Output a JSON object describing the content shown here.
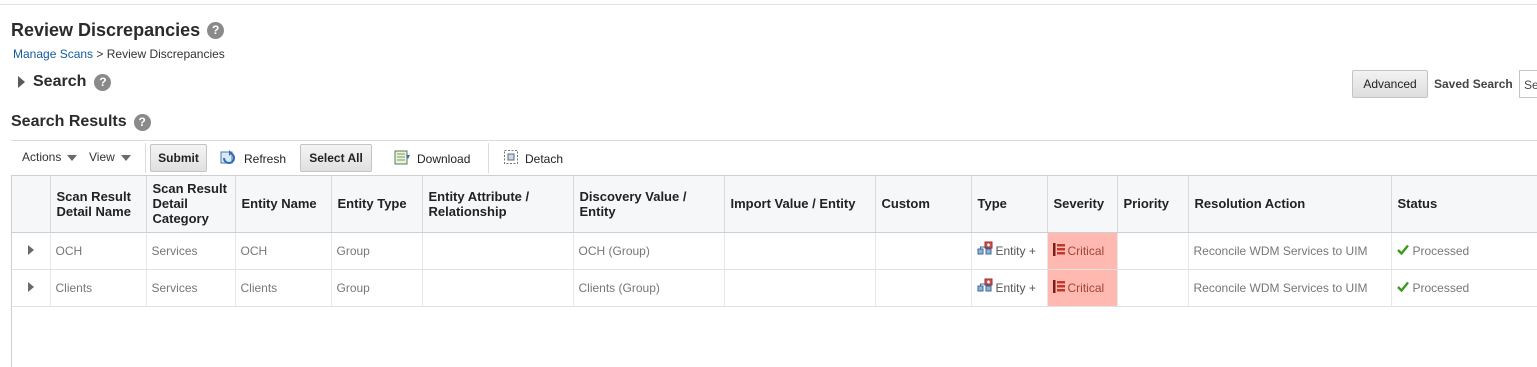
{
  "page": {
    "title": "Review Discrepancies",
    "breadcrumb": {
      "parent": "Manage Scans",
      "separator": ">",
      "current": "Review Discrepancies"
    }
  },
  "search": {
    "label": "Search",
    "advanced_label": "Advanced",
    "saved_search_label": "Saved Search",
    "saved_search_value": "Se"
  },
  "results": {
    "title": "Search Results",
    "toolbar": {
      "actions_label": "Actions",
      "view_label": "View",
      "submit_label": "Submit",
      "refresh_label": "Refresh",
      "select_all_label": "Select All",
      "download_label": "Download",
      "detach_label": "Detach"
    },
    "columns": [
      "Scan Result Detail Name",
      "Scan Result Detail Category",
      "Entity Name",
      "Entity Type",
      "Entity Attribute / Relationship",
      "Discovery Value / Entity",
      "Import Value / Entity",
      "Custom",
      "Type",
      "Severity",
      "Priority",
      "Resolution Action",
      "Status"
    ],
    "rows": [
      {
        "detail_name": "OCH",
        "category": "Services",
        "entity_name": "OCH",
        "entity_type": "Group",
        "attribute": "",
        "discovery_value": "OCH (Group)",
        "import_value": "",
        "custom": "",
        "type": "Entity +",
        "severity": "Critical",
        "priority": "",
        "resolution": "Reconcile WDM Services to UIM",
        "status": "Processed"
      },
      {
        "detail_name": "Clients",
        "category": "Services",
        "entity_name": "Clients",
        "entity_type": "Group",
        "attribute": "",
        "discovery_value": "Clients (Group)",
        "import_value": "",
        "custom": "",
        "type": "Entity +",
        "severity": "Critical",
        "priority": "",
        "resolution": "Reconcile WDM Services to UIM",
        "status": "Processed"
      }
    ]
  },
  "colors": {
    "critical_bg": "#ffb9b0",
    "link": "#145c9e",
    "status_ok": "#3c9a1c",
    "severity_icon": "#c0392b"
  },
  "icons": [
    "help-icon",
    "expand-icon",
    "chevron-down-icon",
    "refresh-icon",
    "download-icon",
    "detach-icon",
    "entity-type-icon",
    "critical-severity-icon",
    "checkmark-icon"
  ]
}
